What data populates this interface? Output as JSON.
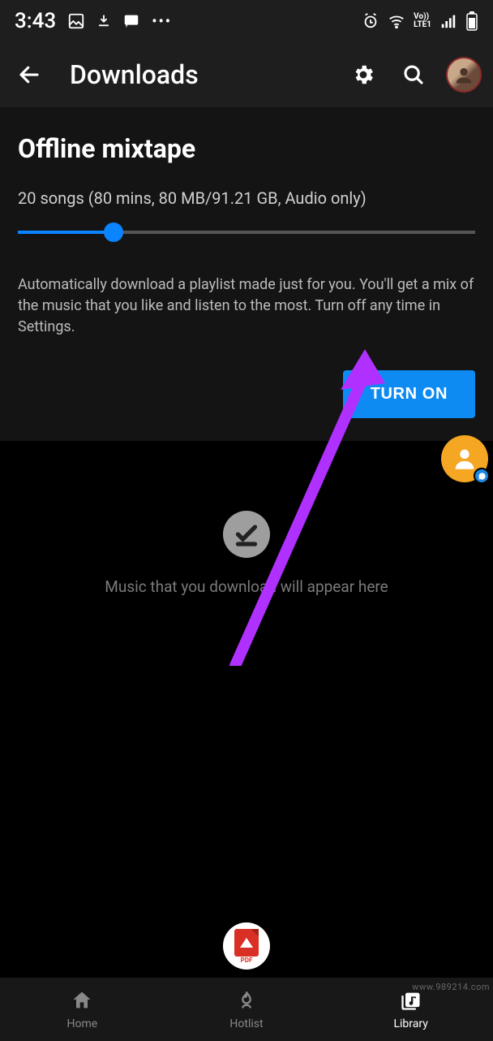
{
  "status": {
    "time": "3:43",
    "icons_left": [
      "image",
      "download",
      "chat",
      "more"
    ],
    "icons_right": [
      "alarm",
      "wifi",
      "volte",
      "signal",
      "battery"
    ]
  },
  "appbar": {
    "title": "Downloads"
  },
  "card": {
    "title": "Offline mixtape",
    "subtitle": "20 songs (80 mins, 80 MB/91.21 GB, Audio only)",
    "description": "Automatically download a playlist made just for you. You'll get a mix of the music that you like and listen to the most. Turn off any time in Settings.",
    "button": "TURN ON",
    "slider_pct": 21
  },
  "empty": {
    "text": "Music that you download will appear here"
  },
  "nav": {
    "items": [
      {
        "label": "Home"
      },
      {
        "label": "Hotlist"
      },
      {
        "label": "Library"
      }
    ],
    "active_index": 2
  },
  "pdf_label": "PDF",
  "watermark": "www.989214.com"
}
